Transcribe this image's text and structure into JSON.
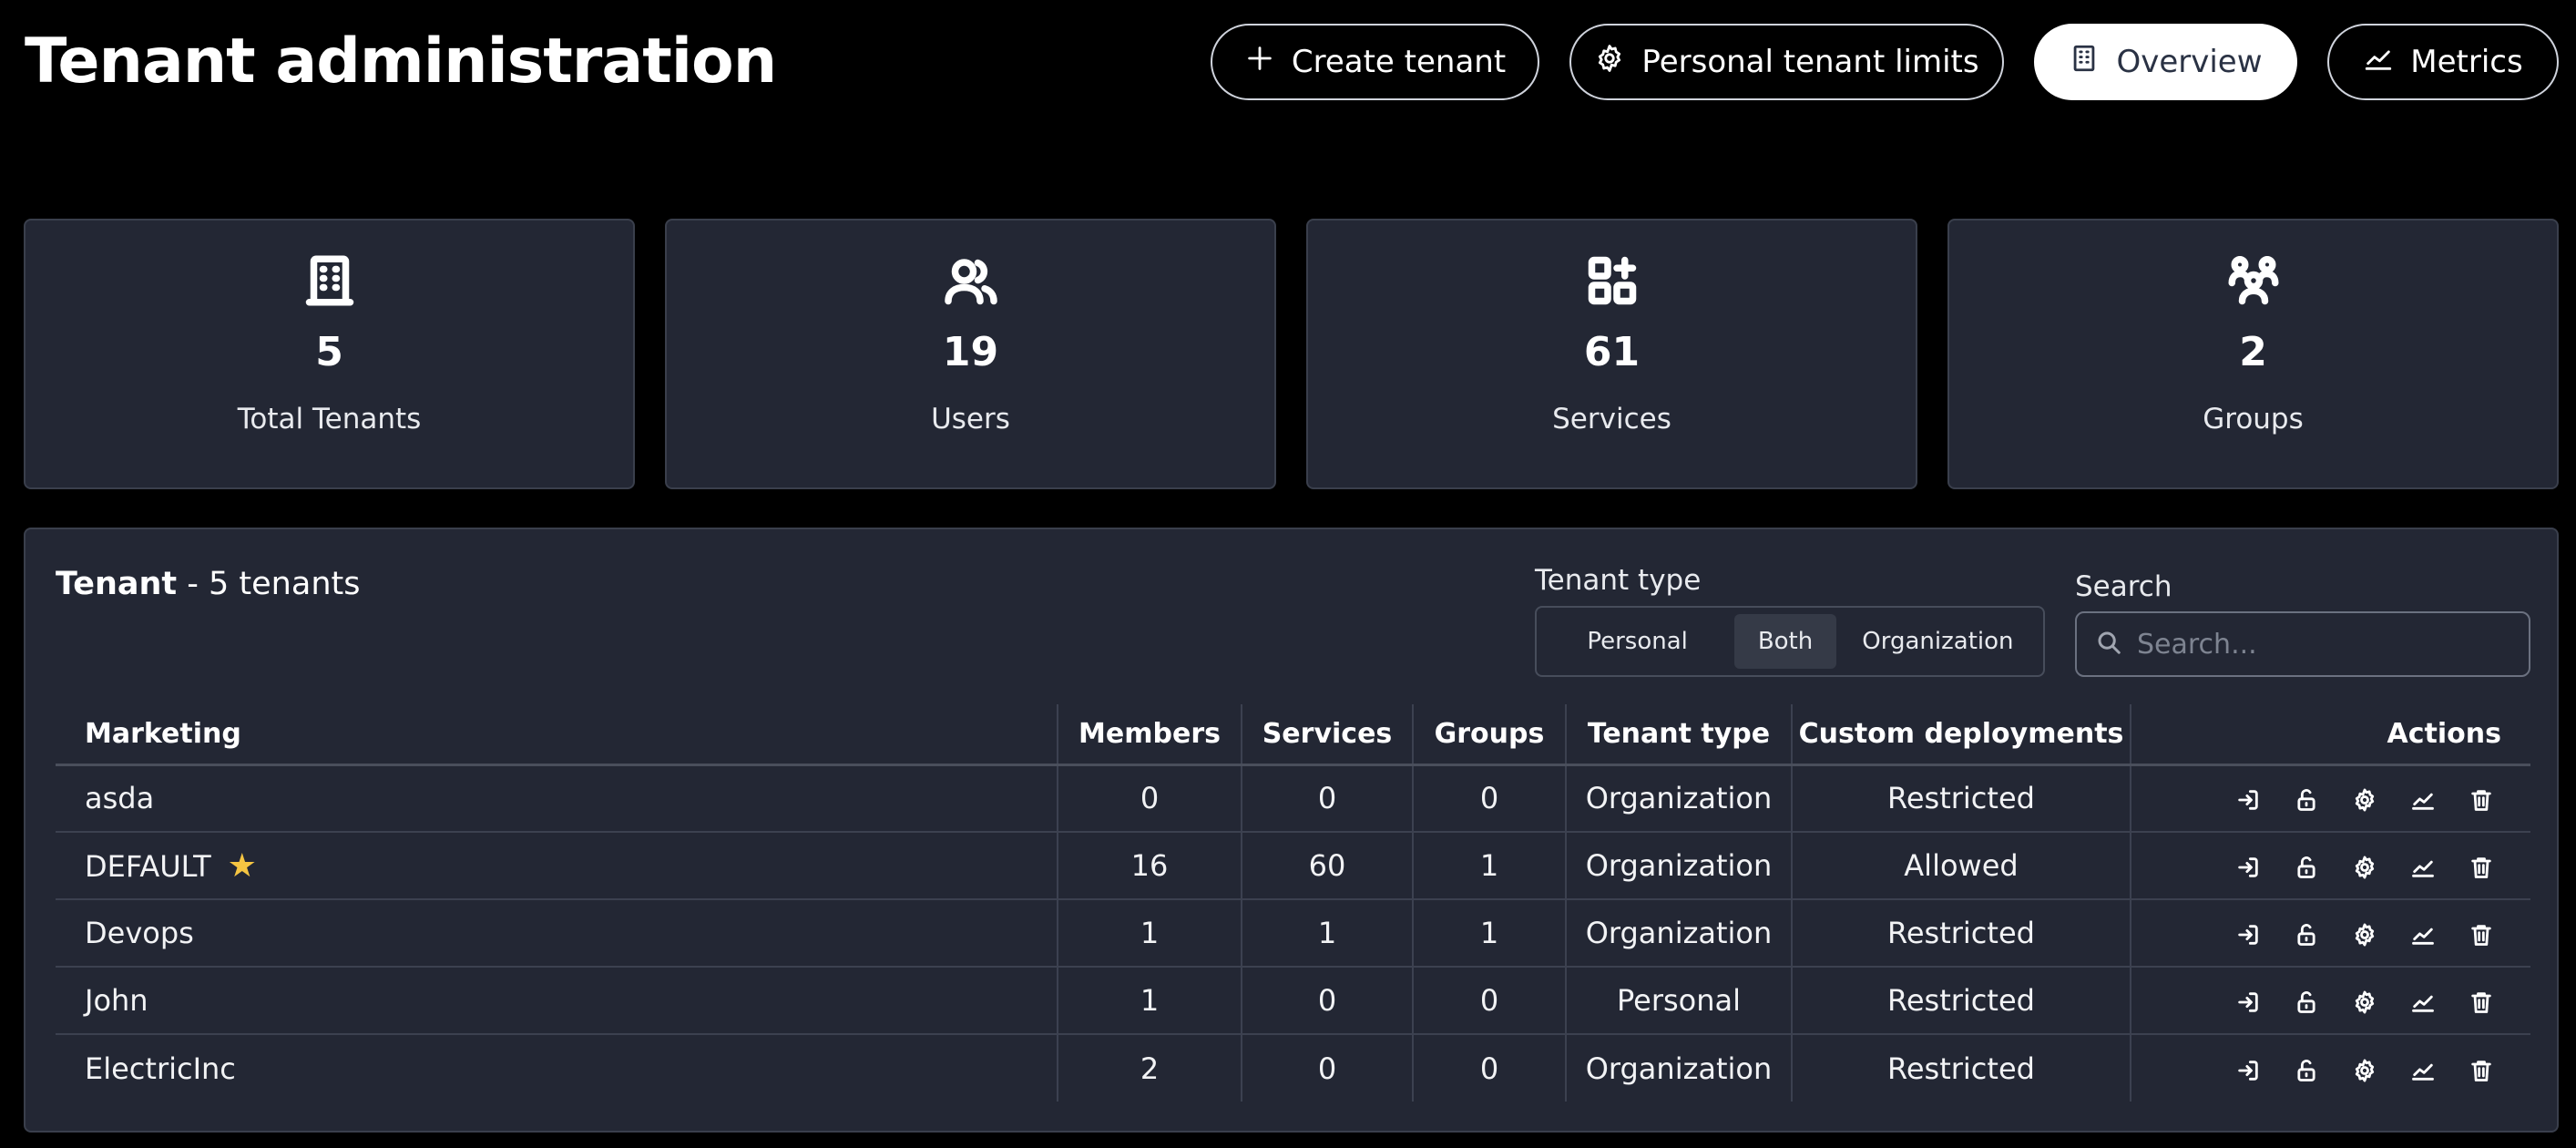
{
  "header": {
    "title": "Tenant administration",
    "buttons": {
      "create": "Create tenant",
      "limits": "Personal tenant limits",
      "overview": "Overview",
      "metrics": "Metrics"
    },
    "active_button": "Overview"
  },
  "stats": [
    {
      "icon": "building-icon",
      "value": "5",
      "label": "Total Tenants"
    },
    {
      "icon": "users-icon",
      "value": "19",
      "label": "Users"
    },
    {
      "icon": "apps-add-icon",
      "value": "61",
      "label": "Services"
    },
    {
      "icon": "group-icon",
      "value": "2",
      "label": "Groups"
    }
  ],
  "panel": {
    "heading_bold": "Tenant",
    "heading_rest": " - 5 tenants",
    "filter_label": "Tenant type",
    "filter_options": [
      "Personal",
      "Both",
      "Organization"
    ],
    "filter_selected": "Both",
    "search_label": "Search",
    "search_placeholder": "Search..."
  },
  "table": {
    "columns": [
      "Marketing",
      "Members",
      "Services",
      "Groups",
      "Tenant type",
      "Custom deployments",
      "Actions"
    ],
    "rows": [
      {
        "name": "asda",
        "members": "0",
        "services": "0",
        "groups": "0",
        "type": "Organization",
        "custom": "Restricted",
        "starred": false
      },
      {
        "name": "DEFAULT",
        "members": "16",
        "services": "60",
        "groups": "1",
        "type": "Organization",
        "custom": "Allowed",
        "starred": true
      },
      {
        "name": "Devops",
        "members": "1",
        "services": "1",
        "groups": "1",
        "type": "Organization",
        "custom": "Restricted",
        "starred": false
      },
      {
        "name": "John",
        "members": "1",
        "services": "0",
        "groups": "0",
        "type": "Personal",
        "custom": "Restricted",
        "starred": false
      },
      {
        "name": "ElectricInc",
        "members": "2",
        "services": "0",
        "groups": "0",
        "type": "Organization",
        "custom": "Restricted",
        "starred": false
      }
    ],
    "row_actions": [
      "login-icon",
      "unlock-icon",
      "settings-icon",
      "metrics-icon",
      "trash-icon"
    ]
  },
  "colors": {
    "background": "#000000",
    "card": "#232734",
    "border": "#3a3f4c",
    "star": "#f5c542",
    "active_pill_text": "#2a3244"
  }
}
